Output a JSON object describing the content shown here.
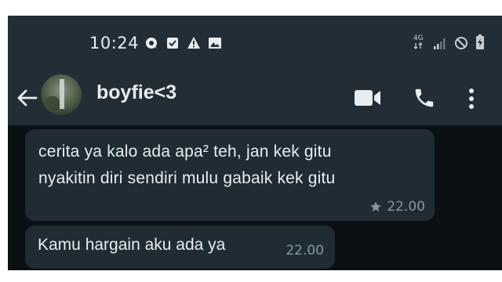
{
  "status_bar": {
    "time": "10:24",
    "network": "4G",
    "icons": [
      "messenger-icon",
      "checkbox-icon",
      "warning-icon",
      "image-icon",
      "signal-icon",
      "no-disturb-icon",
      "battery-icon"
    ]
  },
  "header": {
    "contact_name": "boyfie<3",
    "icons": [
      "back-arrow-icon",
      "video-call-icon",
      "phone-icon",
      "more-vert-icon"
    ]
  },
  "messages": [
    {
      "lines": [
        "cerita ya kalo ada apa² teh, jan kek gitu",
        "nyakitin diri sendiri mulu gabaik kek gitu"
      ],
      "time": "22.00",
      "starred": true
    },
    {
      "text": "Kamu hargain aku ada ya",
      "time": "22.00",
      "starred": false
    }
  ],
  "colors": {
    "chat_background": "#0b1014",
    "bar_background": "#232d36",
    "bubble": "#1f2c34",
    "text": "#e9edef",
    "meta": "#8696a0"
  }
}
